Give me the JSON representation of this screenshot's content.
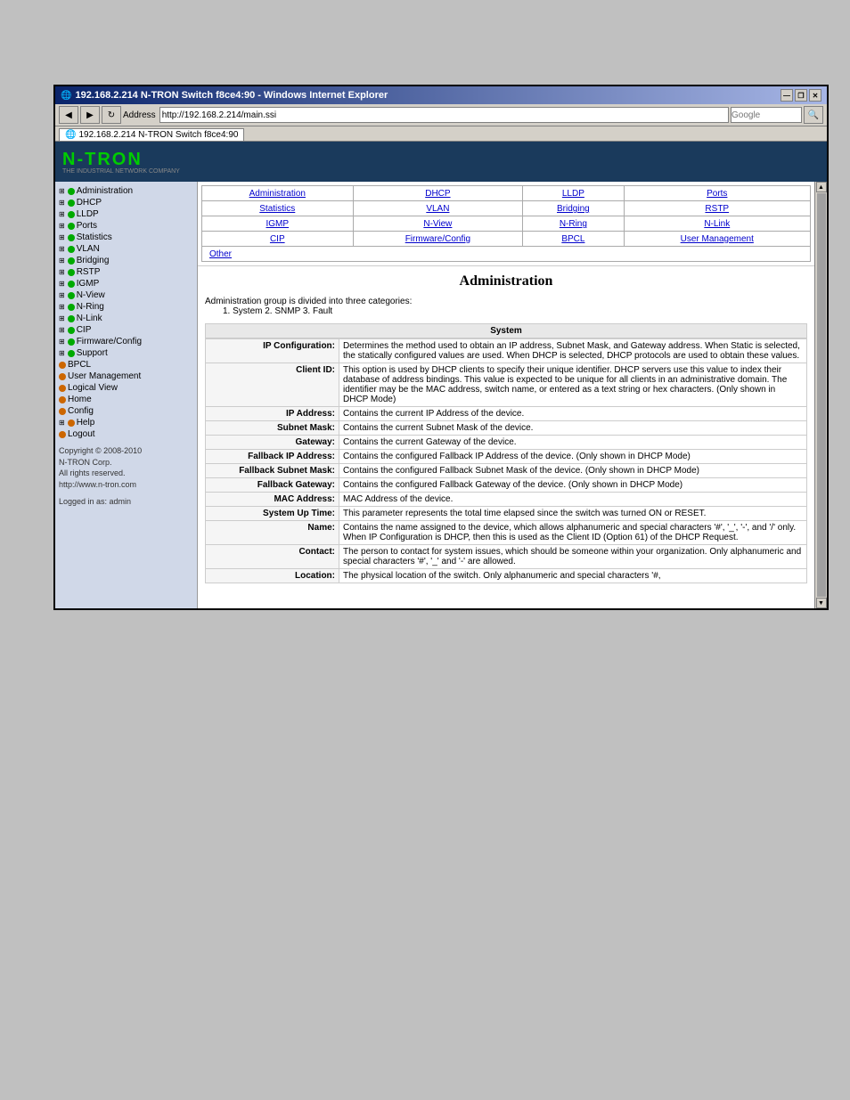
{
  "window": {
    "title": "192.168.2.214 N-TRON Switch f8ce4:90 - Windows Internet Explorer",
    "address": "http://192.168.2.214/main.ssi",
    "tab_label": "192.168.2.214 N-TRON Switch f8ce4:90",
    "search_placeholder": "Google",
    "controls": {
      "minimize": "—",
      "restore": "❐",
      "close": "✕"
    }
  },
  "banner": {
    "logo": "N-TRON",
    "logo_sub": "THE INDUSTRIAL NETWORK COMPANY"
  },
  "sidebar": {
    "items": [
      {
        "label": "Administration",
        "bullet": "green",
        "expand": "⊞"
      },
      {
        "label": "DHCP",
        "bullet": "green",
        "expand": "⊞"
      },
      {
        "label": "LLDP",
        "bullet": "green",
        "expand": "⊞"
      },
      {
        "label": "Ports",
        "bullet": "green",
        "expand": "⊞"
      },
      {
        "label": "Statistics",
        "bullet": "green",
        "expand": "⊞"
      },
      {
        "label": "VLAN",
        "bullet": "green",
        "expand": "⊞"
      },
      {
        "label": "Bridging",
        "bullet": "green",
        "expand": "⊞"
      },
      {
        "label": "RSTP",
        "bullet": "green",
        "expand": "⊞"
      },
      {
        "label": "IGMP",
        "bullet": "green",
        "expand": "⊞"
      },
      {
        "label": "N-View",
        "bullet": "green",
        "expand": "⊞"
      },
      {
        "label": "N-Ring",
        "bullet": "green",
        "expand": "⊞"
      },
      {
        "label": "N-Link",
        "bullet": "green",
        "expand": "⊞"
      },
      {
        "label": "CIP",
        "bullet": "green",
        "expand": "⊞"
      },
      {
        "label": "Firmware/Config",
        "bullet": "green",
        "expand": "⊞"
      },
      {
        "label": "Support",
        "bullet": "green",
        "expand": "⊞"
      },
      {
        "label": "BPCL",
        "bullet": "orange"
      },
      {
        "label": "User Management",
        "bullet": "orange"
      },
      {
        "label": "Logical View",
        "bullet": "orange"
      },
      {
        "label": "Home",
        "bullet": "orange"
      },
      {
        "label": "Config",
        "bullet": "orange"
      },
      {
        "label": "Help",
        "bullet": "orange",
        "expand": "⊞"
      },
      {
        "label": "Logout",
        "bullet": "orange"
      }
    ],
    "copyright": "Copyright © 2008-2010\nN-TRON Corp.\nAll rights reserved.\nhttp://www.n-tron.com",
    "logged_in": "Logged in as: admin"
  },
  "nav_links": {
    "row1": [
      {
        "label": "Administration",
        "col": 1
      },
      {
        "label": "DHCP",
        "col": 2
      },
      {
        "label": "LLDP",
        "col": 3
      },
      {
        "label": "Ports",
        "col": 4
      }
    ],
    "row2": [
      {
        "label": "Statistics",
        "col": 1
      },
      {
        "label": "VLAN",
        "col": 2
      },
      {
        "label": "Bridging",
        "col": 3
      },
      {
        "label": "RSTP",
        "col": 4
      }
    ],
    "row3": [
      {
        "label": "IGMP",
        "col": 1
      },
      {
        "label": "N-View",
        "col": 2
      },
      {
        "label": "N-Ring",
        "col": 3
      },
      {
        "label": "N-Link",
        "col": 4
      }
    ],
    "row4": [
      {
        "label": "CIP",
        "col": 1
      },
      {
        "label": "Firmware/Config",
        "col": 2
      },
      {
        "label": "BPCL",
        "col": 3
      },
      {
        "label": "User Management",
        "col": 4
      }
    ],
    "row5": [
      {
        "label": "Other",
        "col": 1
      }
    ]
  },
  "admin": {
    "title": "Administration",
    "intro": "Administration group is divided into three categories:",
    "categories": "1. System  2. SNMP  3. Fault",
    "system_header": "System",
    "rows": [
      {
        "label": "IP Configuration:",
        "text": "Determines the method used to obtain an IP address, Subnet Mask, and Gateway address. When Static is selected, the statically configured values are used. When DHCP is selected, DHCP protocols are used to obtain these values."
      },
      {
        "label": "Client ID:",
        "text": "This option is used by DHCP clients to specify their unique identifier. DHCP servers use this value to index their database of address bindings. This value is expected to be unique for all clients in an administrative domain. The identifier may be the MAC address, switch name, or entered as a text string or hex characters. (Only shown in DHCP Mode)"
      },
      {
        "label": "IP Address:",
        "text": "Contains the current IP Address of the device."
      },
      {
        "label": "Subnet Mask:",
        "text": "Contains the current Subnet Mask of the device."
      },
      {
        "label": "Gateway:",
        "text": "Contains the current Gateway of the device."
      },
      {
        "label": "Fallback IP Address:",
        "text": "Contains the configured Fallback IP Address of the device. (Only shown in DHCP Mode)"
      },
      {
        "label": "Fallback Subnet Mask:",
        "text": "Contains the configured Fallback Subnet Mask of the device. (Only shown in DHCP Mode)"
      },
      {
        "label": "Fallback Gateway:",
        "text": "Contains the configured Fallback Gateway of the device. (Only shown in DHCP Mode)"
      },
      {
        "label": "MAC Address:",
        "text": "MAC Address of the device."
      },
      {
        "label": "System Up Time:",
        "text": "This parameter represents the total time elapsed since the switch was turned ON or RESET."
      },
      {
        "label": "Name:",
        "text": "Contains the name assigned to the device, which allows alphanumeric and special characters '#', '_', '-', and '/' only. When IP Configuration is DHCP, then this is used as the Client ID (Option 61) of the DHCP Request."
      },
      {
        "label": "Contact:",
        "text": "The person to contact for system issues, which should be someone within your organization. Only alphanumeric and special characters '#', '_' and '-' are allowed."
      },
      {
        "label": "Location:",
        "text": "The physical location of the switch. Only alphanumeric and special characters '#,"
      }
    ]
  }
}
